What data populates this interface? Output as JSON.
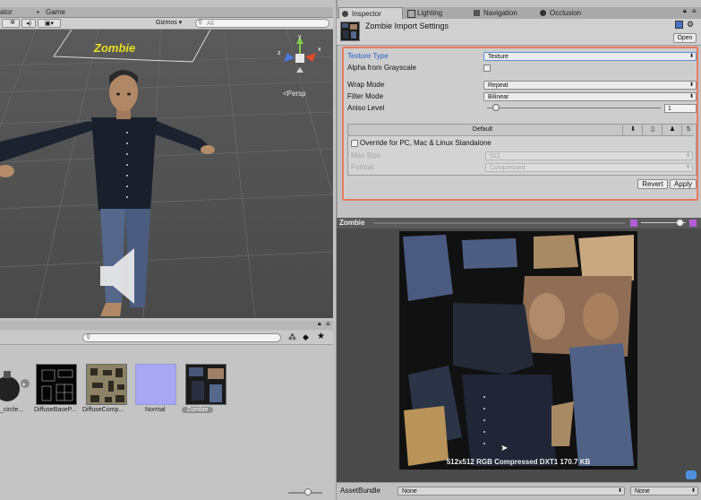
{
  "left_tabs": {
    "animator": "ator",
    "game": "Game"
  },
  "scene_toolbar": {
    "gizmos": "Gizmos",
    "gizmos_arrow": "▾",
    "search_placeholder": "All"
  },
  "scene": {
    "model_label": "Zombie",
    "persp_label": "Persp",
    "axis_y": "y",
    "axis_x": "x",
    "axis_z": "z"
  },
  "project": {
    "search_placeholder": "",
    "items": [
      {
        "label": "_circle..."
      },
      {
        "label": "DiffuseBaseP..."
      },
      {
        "label": "DiffuseComp..."
      },
      {
        "label": "Normal"
      },
      {
        "label": "Zombie"
      }
    ]
  },
  "inspector_tabs": [
    {
      "label": "Inspector"
    },
    {
      "label": "Lighting"
    },
    {
      "label": "Navigation"
    },
    {
      "label": "Occlusion"
    }
  ],
  "inspector": {
    "title": "Zombie Import Settings",
    "open_label": "Open",
    "texture_type_label": "Texture Type",
    "texture_type_value": "Texture",
    "alpha_label": "Alpha from Grayscale",
    "wrap_label": "Wrap Mode",
    "wrap_value": "Repeat",
    "filter_label": "Filter Mode",
    "filter_value": "Bilinear",
    "aniso_label": "Aniso Level",
    "aniso_value": "1",
    "aniso_fraction": 0.05,
    "platform_default": "Default",
    "override_label": "Override for PC, Mac & Linux Standalone",
    "max_size_label": "Max Size",
    "max_size_value": "512",
    "format_label": "Format",
    "format_value": "Compressed",
    "revert_label": "Revert",
    "apply_label": "Apply"
  },
  "preview": {
    "title": "Zombie",
    "info": "512x512  RGB Compressed DXT1   170.7 KB"
  },
  "assetbundle": {
    "label": "AssetBundle",
    "value1": "None",
    "value2": "None"
  },
  "colors": {
    "highlight_border": "#e8795f",
    "field_blue": "#1e5fc7",
    "zombie_label": "#e8e020"
  }
}
